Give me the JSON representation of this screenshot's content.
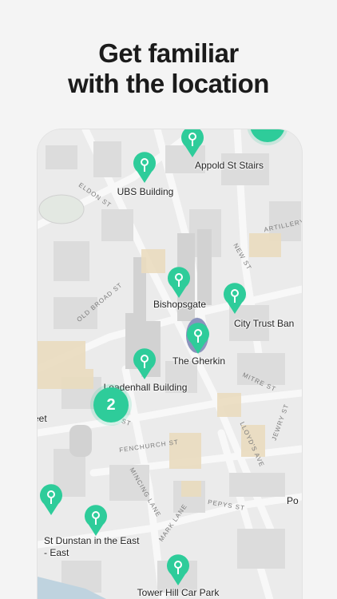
{
  "headline": {
    "line1": "Get familiar",
    "line2": "with the location"
  },
  "map": {
    "accent_color": "#2ecc9a",
    "markers": [
      {
        "label": "Appold St Stairs"
      },
      {
        "label": "UBS Building"
      },
      {
        "label": "Bishopsgate"
      },
      {
        "label": "City Trust Ban"
      },
      {
        "label": "The Gherkin"
      },
      {
        "label": "Leadenhall Building"
      },
      {
        "label": "St Dunstan in the East"
      },
      {
        "label": "- East"
      },
      {
        "label": "Tower Hill Car Park"
      }
    ],
    "cluster_count": "2",
    "edge_labels": {
      "left": "eet",
      "right": "Po"
    },
    "street_labels": [
      "ELDON ST",
      "ARTILLERY",
      "NEW ST",
      "OLD BROAD ST",
      "LIME ST",
      "FENCHURCH ST",
      "MINCING LANE",
      "MARK LANE",
      "PEPYS ST",
      "LLOYD'S AVE",
      "JEWRY ST",
      "MITRE ST"
    ]
  }
}
